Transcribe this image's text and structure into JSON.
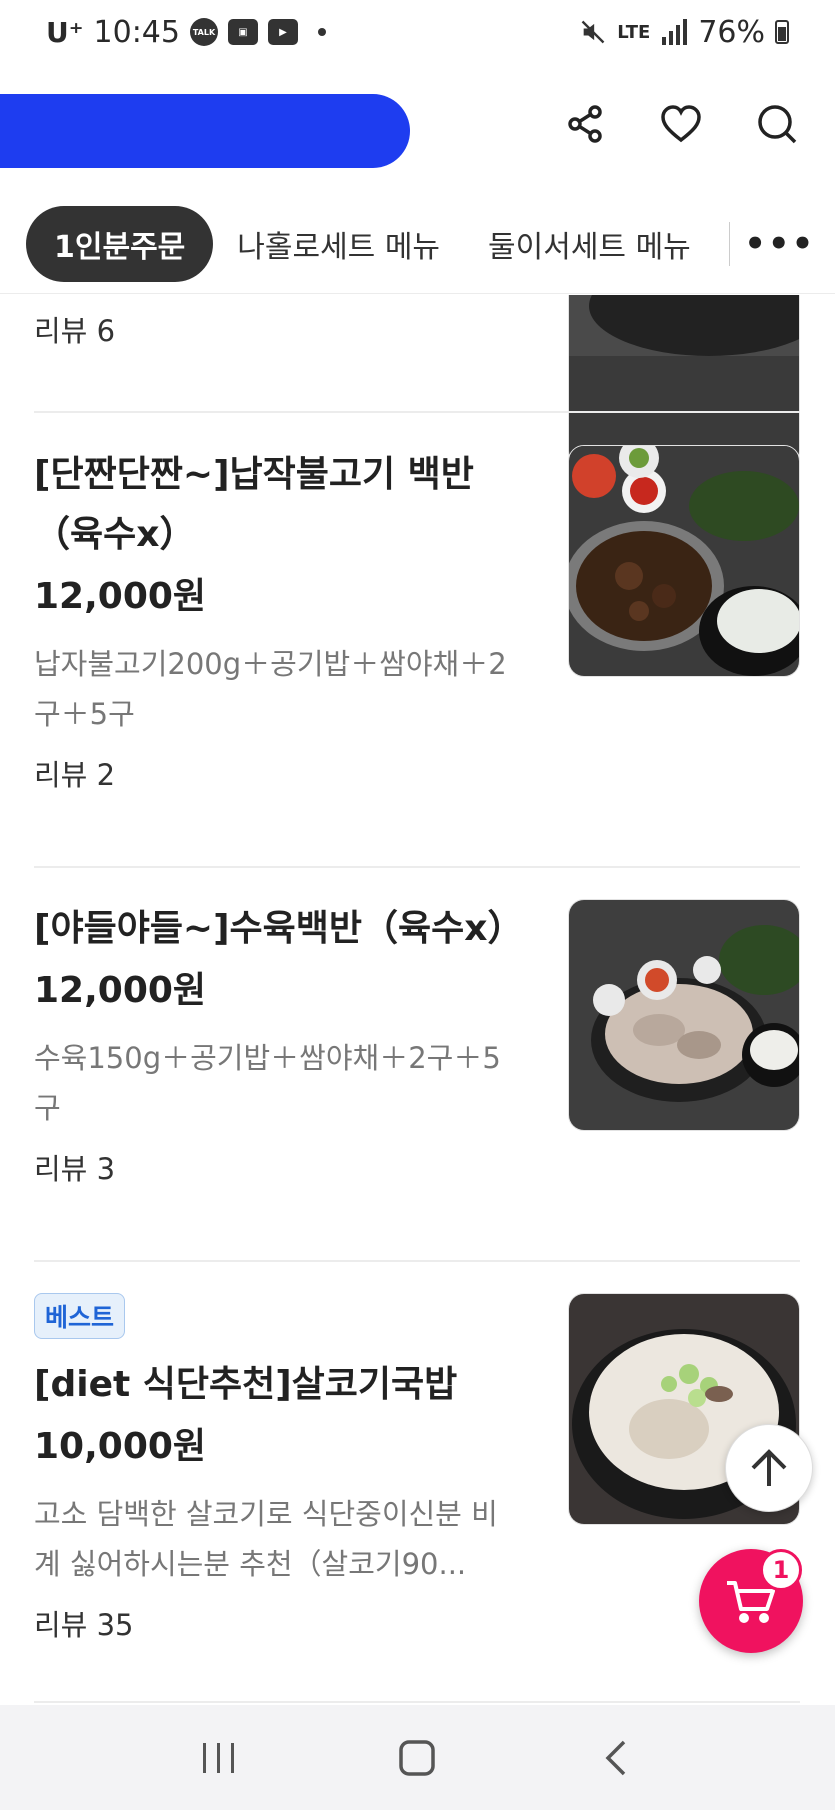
{
  "status_bar": {
    "carrier": "U⁺",
    "time": "10:45",
    "notif_talk": "TALK",
    "network": "LTE",
    "battery": "76%"
  },
  "header": {
    "store_name": "",
    "icons": [
      "share-icon",
      "heart-icon",
      "search-icon"
    ]
  },
  "tabs": [
    {
      "label": "1인분주문",
      "active": true
    },
    {
      "label": "나홀로세트 메뉴",
      "active": false
    },
    {
      "label": "둘이서세트 메뉴",
      "active": false
    }
  ],
  "menu": {
    "partial_item": {
      "reviews": "리뷰 6"
    },
    "items": [
      {
        "name": "[단짠단짠~]납작불고기 백반（육수x）",
        "price": "12,000원",
        "description": "납자불고기200g＋공기밥＋쌈야채＋2구＋5구",
        "reviews": "리뷰 2"
      },
      {
        "name": "[야들야들~]수육백반（육수x）",
        "price": "12,000원",
        "description": "수육150g＋공기밥＋쌈야채＋2구＋5구",
        "reviews": "리뷰 3"
      },
      {
        "badge": "베스트",
        "name": "[diet 식단추천]살코기국밥",
        "price": "10,000원",
        "description": "고소 담백한 살코기로 식단중이신분 비계 싫어하시는분 추천（살코기90...",
        "reviews": "리뷰 35"
      }
    ]
  },
  "cart": {
    "count": "1"
  },
  "colors": {
    "accent": "#f0125f",
    "badge": "#1f64d6",
    "tab_active": "#333333"
  }
}
